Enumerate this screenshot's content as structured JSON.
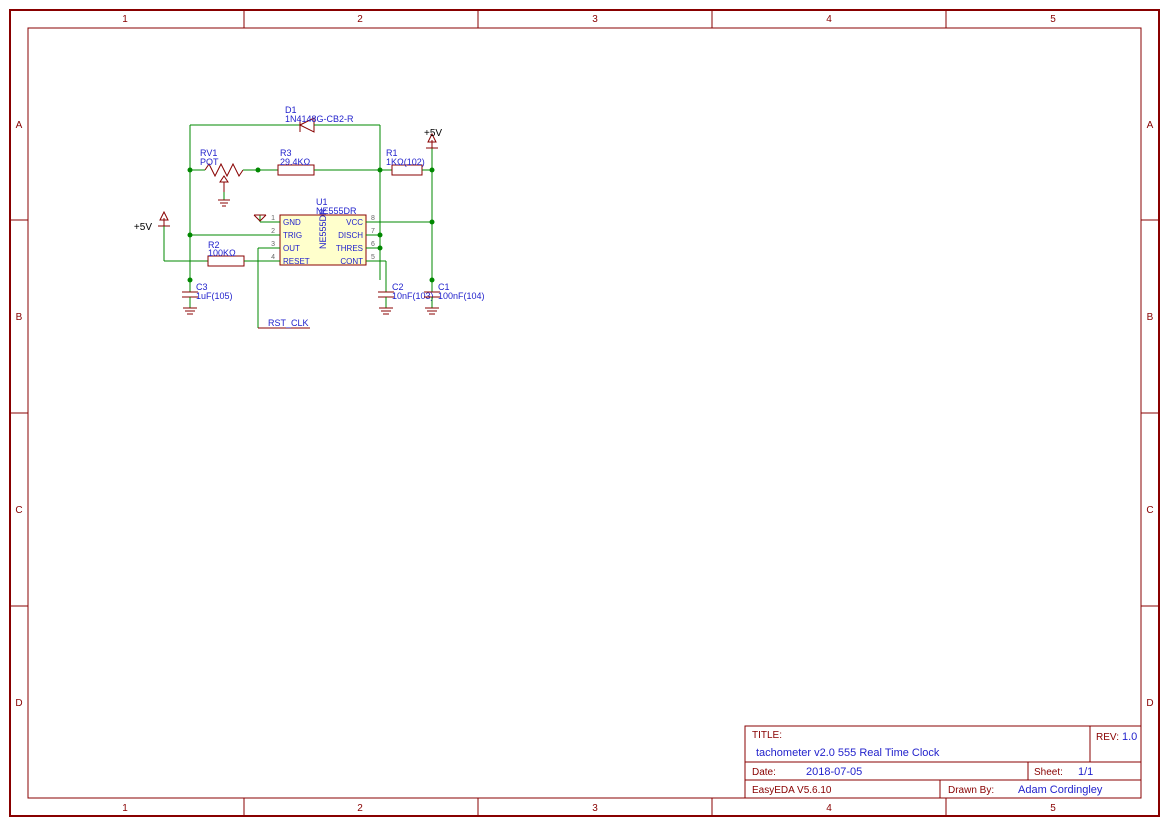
{
  "frame": {
    "cols": [
      "1",
      "2",
      "3",
      "4",
      "5"
    ],
    "rows": [
      "A",
      "B",
      "C",
      "D"
    ]
  },
  "components": {
    "D1": {
      "ref": "D1",
      "val": "1N4148G-CB2-R"
    },
    "RV1": {
      "ref": "RV1",
      "val": "POT"
    },
    "R1": {
      "ref": "R1",
      "val": "1KΩ(102)"
    },
    "R2": {
      "ref": "R2",
      "val": "100KΩ"
    },
    "R3": {
      "ref": "R3",
      "val": "29.4KΩ"
    },
    "C1": {
      "ref": "C1",
      "val": "100nF(104)"
    },
    "C2": {
      "ref": "C2",
      "val": "10nF(103)"
    },
    "C3": {
      "ref": "C3",
      "val": "1uF(105)"
    },
    "U1": {
      "ref": "U1",
      "val": "NE555DR",
      "part": "NE555DR",
      "pins_left": [
        {
          "n": "1",
          "name": "GND"
        },
        {
          "n": "2",
          "name": "TRIG"
        },
        {
          "n": "3",
          "name": "OUT"
        },
        {
          "n": "4",
          "name": "RESET"
        }
      ],
      "pins_right": [
        {
          "n": "8",
          "name": "VCC"
        },
        {
          "n": "7",
          "name": "DISCH"
        },
        {
          "n": "6",
          "name": "THRES"
        },
        {
          "n": "5",
          "name": "CONT"
        }
      ]
    }
  },
  "power": {
    "p5v_left": "+5V",
    "p5v_right": "+5V"
  },
  "nets": {
    "rst_clk": "RST_CLK"
  },
  "titleblock": {
    "title_label": "TITLE:",
    "title": "tachometer v2.0 555 Real Time Clock",
    "rev_label": "REV:",
    "rev": "1.0",
    "date_label": "Date:",
    "date": "2018-07-05",
    "sheet_label": "Sheet:",
    "sheet": "1/1",
    "tool": "EasyEDA V5.6.10",
    "drawn_label": "Drawn By:",
    "drawn": "Adam Cordingley"
  }
}
